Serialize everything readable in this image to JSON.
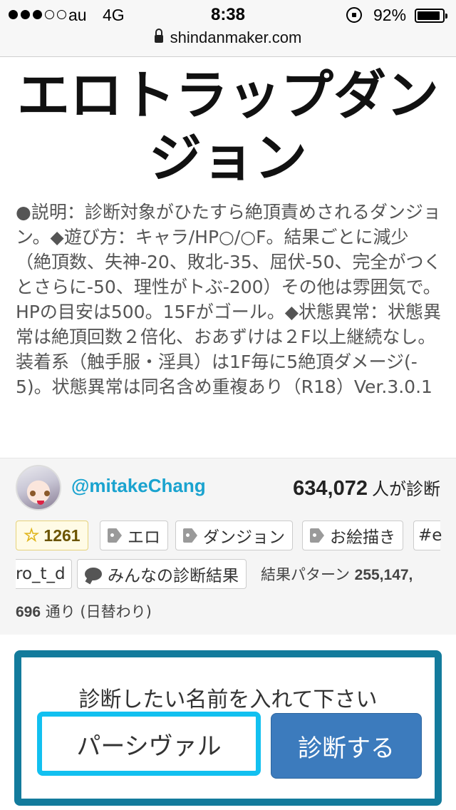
{
  "status_bar": {
    "carrier": "au",
    "network": "4G",
    "time": "8:38",
    "battery_percent": "92%",
    "battery_level": 0.92,
    "signal_bars_filled": 3,
    "signal_bars_total": 5,
    "url": "shindanmaker.com"
  },
  "page": {
    "title": "エロトラップダンジョン",
    "description": "●説明：診断対象がひたすら絶頂責めされるダンジョン。◆遊び方：キャラ/HP○/○F。結果ごとに減少（絶頂数、失神-20、敗北-35、屈伏-50、完全がつくとさらに-50、理性がトぶ-200）その他は雰囲気で。HPの目安は500。15Fがゴール。◆状態異常：状態異常は絶頂回数２倍化、おあずけは２F以上継続なし。装着系（触手服・淫具）は1F毎に5絶頂ダメージ(-5)。状態異常は同名含め重複あり（R18）Ver.3.0.1"
  },
  "info": {
    "author": "@mitakeChang",
    "diagnosis_count": "634,072",
    "diagnosis_count_suffix": "人が診断",
    "favorites": "1261",
    "tags": [
      "エロ",
      "ダンジョン",
      "お絵描き"
    ],
    "tag_partial_start": "#e",
    "tag_partial_end": "ro_t_d",
    "results_link": "みんなの診断結果",
    "patterns_label": "結果パターン",
    "patterns_count_part1": "255,147,",
    "patterns_count_part2": "696",
    "patterns_suffix": "通り (日替わり)"
  },
  "form": {
    "prompt": "診断したい名前を入れて下さい",
    "name_value": "パーシヴァル",
    "submit_label": "診断する"
  },
  "colors": {
    "author_link": "#1aa3cf",
    "form_border": "#137b9c",
    "input_border": "#12c0f0",
    "button": "#3c7bbd"
  }
}
